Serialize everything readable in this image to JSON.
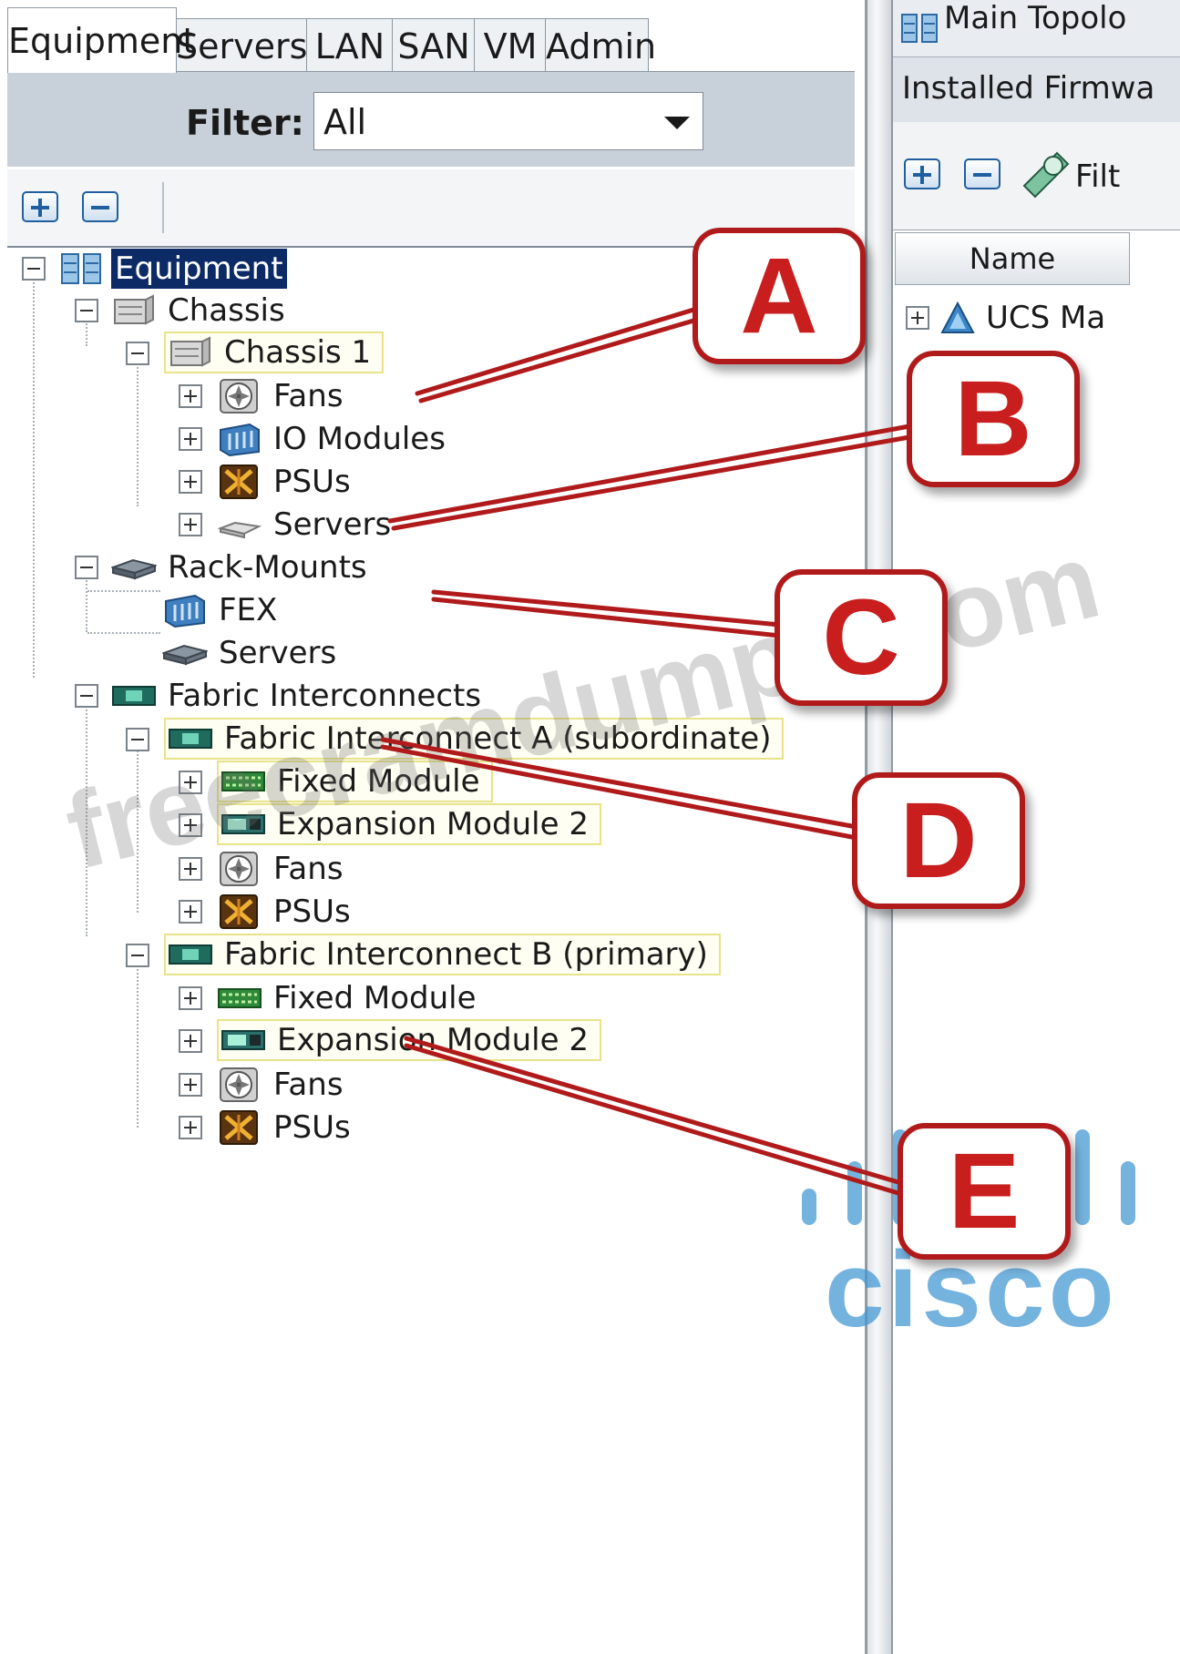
{
  "left_panel": {
    "tabs": [
      {
        "label": "Equipment",
        "active": true
      },
      {
        "label": "Servers"
      },
      {
        "label": "LAN"
      },
      {
        "label": "SAN"
      },
      {
        "label": "VM"
      },
      {
        "label": "Admin"
      }
    ],
    "filter": {
      "label": "Filter:",
      "value": "All"
    },
    "toolbar": {
      "expand_icon": "plus-icon",
      "collapse_icon": "minus-icon"
    },
    "tree": {
      "root": "Equipment",
      "chassis": "Chassis",
      "chassis_1": "Chassis 1",
      "chassis_fans": "Fans",
      "io_modules": "IO Modules",
      "chassis_psus": "PSUs",
      "chassis_servers": "Servers",
      "rack_mounts": "Rack-Mounts",
      "fex": "FEX",
      "rack_servers": "Servers",
      "fabric_interconnects": "Fabric Interconnects",
      "fi_a": "Fabric Interconnect A (subordinate)",
      "fi_a_fixed": "Fixed Module",
      "fi_a_expansion": "Expansion Module 2",
      "fi_a_fans": "Fans",
      "fi_a_psus": "PSUs",
      "fi_b": "Fabric Interconnect B (primary)",
      "fi_b_fixed": "Fixed Module",
      "fi_b_expansion": "Expansion Module 2",
      "fi_b_fans": "Fans",
      "fi_b_psus": "PSUs"
    }
  },
  "right_panel": {
    "tab_label": "Main Topolo",
    "sub_label": "Installed Firmwa",
    "toolbar_filter": "Filt",
    "column_name": "Name",
    "row_label": "UCS Ma"
  },
  "callouts": [
    "A",
    "B",
    "C",
    "D",
    "E"
  ],
  "watermarks": {
    "site": "freecramdumps.com",
    "brand": "cisco"
  },
  "colors": {
    "callout_red": "#c81e1e",
    "selection_navy": "#0b2a66",
    "cisco_blue": "#4096d2"
  }
}
